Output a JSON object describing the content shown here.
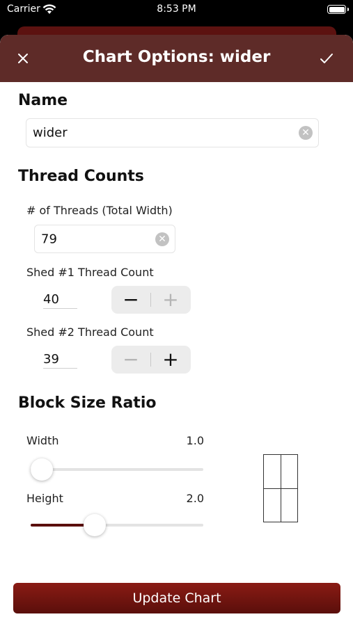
{
  "status_bar": {
    "carrier": "Carrier",
    "time": "8:53 PM"
  },
  "nav": {
    "title": "Chart Options: wider",
    "close_icon": "close-icon",
    "confirm_icon": "checkmark-icon"
  },
  "name_section": {
    "header": "Name",
    "value": "wider"
  },
  "thread_counts": {
    "header": "Thread Counts",
    "total_label": "# of Threads (Total Width)",
    "total_value": "79",
    "shed1_label": "Shed #1 Thread Count",
    "shed1_value": "40",
    "shed2_label": "Shed #2 Thread Count",
    "shed2_value": "39",
    "minus": "−",
    "plus": "+"
  },
  "block_size": {
    "header": "Block Size Ratio",
    "width_label": "Width",
    "width_value": "1.0",
    "width_fraction": 0.0,
    "height_label": "Height",
    "height_value": "2.0",
    "height_fraction": 0.35
  },
  "update_button": "Update Chart",
  "colors": {
    "accent": "#5e2b28",
    "button": "#7a1510",
    "slider_fill": "#5a0e0c"
  }
}
